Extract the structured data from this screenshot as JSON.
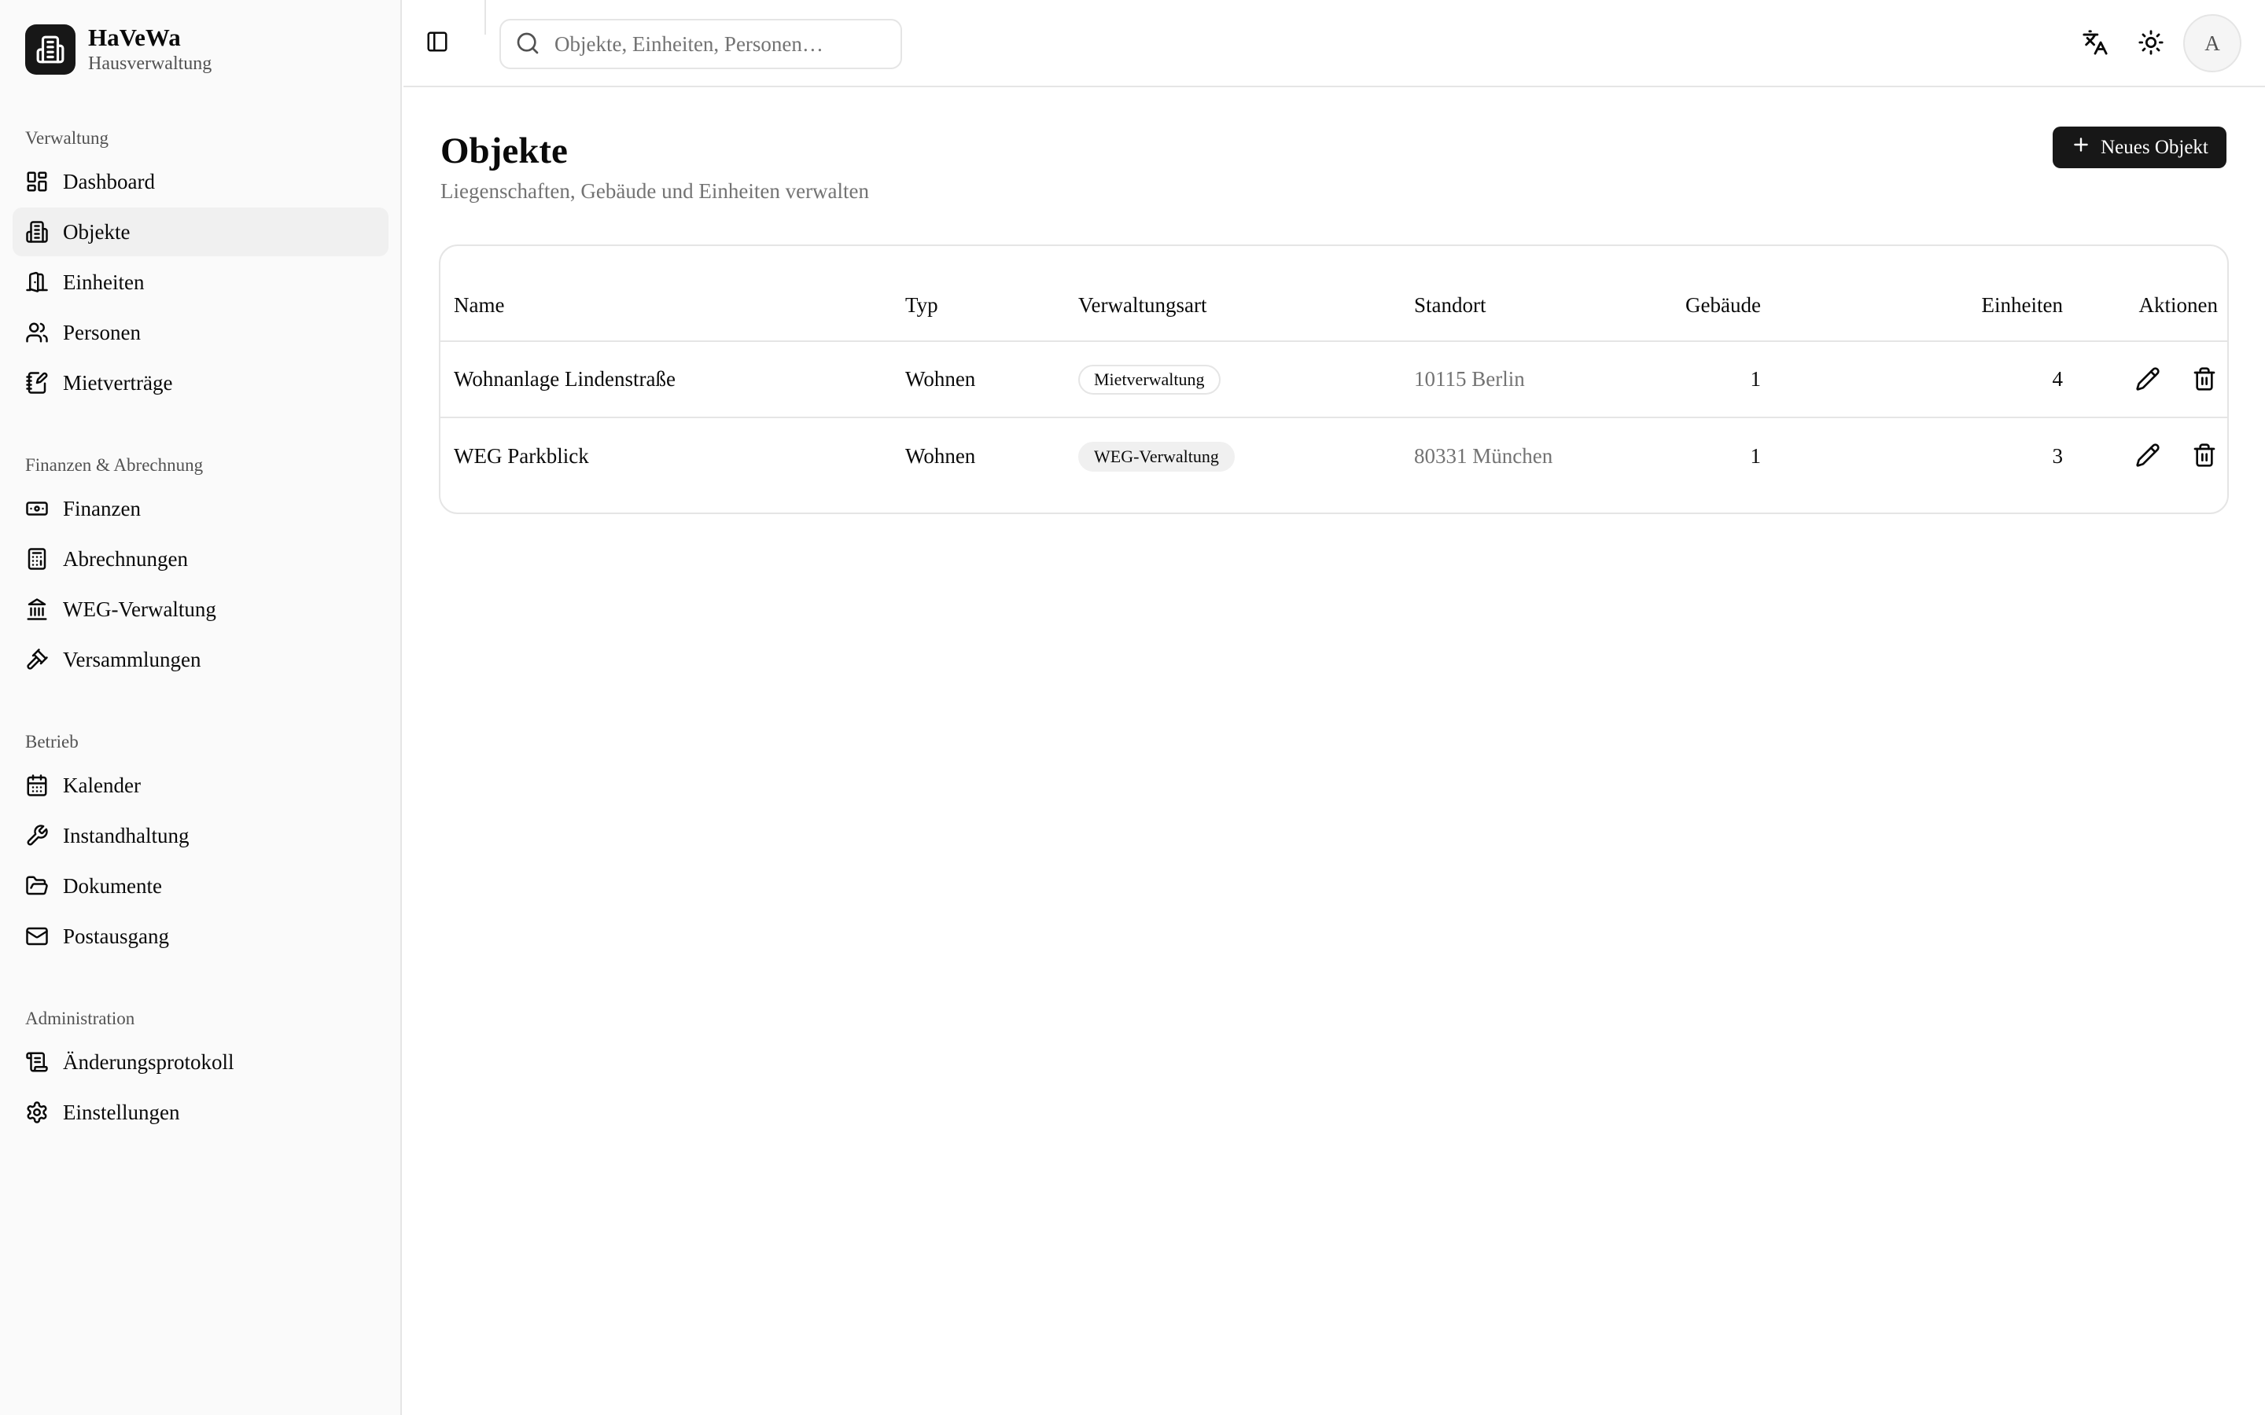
{
  "brand": {
    "name": "HaVeWa",
    "subtitle": "Hausverwaltung",
    "logo_icon": "building-icon"
  },
  "sidebar": {
    "sections": [
      {
        "heading": "Verwaltung",
        "items": [
          {
            "label": "Dashboard",
            "icon": "dashboard-icon"
          },
          {
            "label": "Objekte",
            "icon": "building-icon",
            "active": true
          },
          {
            "label": "Einheiten",
            "icon": "door-icon"
          },
          {
            "label": "Personen",
            "icon": "users-icon"
          },
          {
            "label": "Mietverträge",
            "icon": "contract-icon"
          }
        ]
      },
      {
        "heading": "Finanzen & Abrechnung",
        "items": [
          {
            "label": "Finanzen",
            "icon": "banknote-icon"
          },
          {
            "label": "Abrechnungen",
            "icon": "calculator-icon"
          },
          {
            "label": "WEG-Verwaltung",
            "icon": "landmark-icon"
          },
          {
            "label": "Versammlungen",
            "icon": "gavel-icon"
          }
        ]
      },
      {
        "heading": "Betrieb",
        "items": [
          {
            "label": "Kalender",
            "icon": "calendar-icon"
          },
          {
            "label": "Instandhaltung",
            "icon": "wrench-icon"
          },
          {
            "label": "Dokumente",
            "icon": "folder-icon"
          },
          {
            "label": "Postausgang",
            "icon": "mail-icon"
          }
        ]
      },
      {
        "heading": "Administration",
        "items": [
          {
            "label": "Änderungsprotokoll",
            "icon": "scroll-icon"
          },
          {
            "label": "Einstellungen",
            "icon": "gear-icon"
          }
        ]
      }
    ]
  },
  "header": {
    "search_placeholder": "Objekte, Einheiten, Personen…",
    "search_value": "",
    "avatar_initial": "A"
  },
  "page": {
    "title": "Objekte",
    "subtitle": "Liegenschaften, Gebäude und Einheiten verwalten",
    "new_button_label": "Neues Objekt"
  },
  "table": {
    "columns": {
      "name": "Name",
      "typ": "Typ",
      "verwaltungsart": "Verwaltungsart",
      "standort": "Standort",
      "gebaeude": "Gebäude",
      "einheiten": "Einheiten",
      "aktionen": "Aktionen"
    },
    "rows": [
      {
        "name": "Wohnanlage Lindenstraße",
        "typ": "Wohnen",
        "verwaltungsart": "Mietverwaltung",
        "standort": "10115 Berlin",
        "gebaeude": "1",
        "einheiten": "4"
      },
      {
        "name": "WEG Parkblick",
        "typ": "Wohnen",
        "verwaltungsart": "WEG-Verwaltung",
        "standort": "80331 München",
        "gebaeude": "1",
        "einheiten": "3"
      }
    ]
  },
  "colors": {
    "primary": "#171717",
    "sidebar_bg": "#fafafa",
    "border": "#e5e5e5",
    "muted_text": "#737373"
  }
}
